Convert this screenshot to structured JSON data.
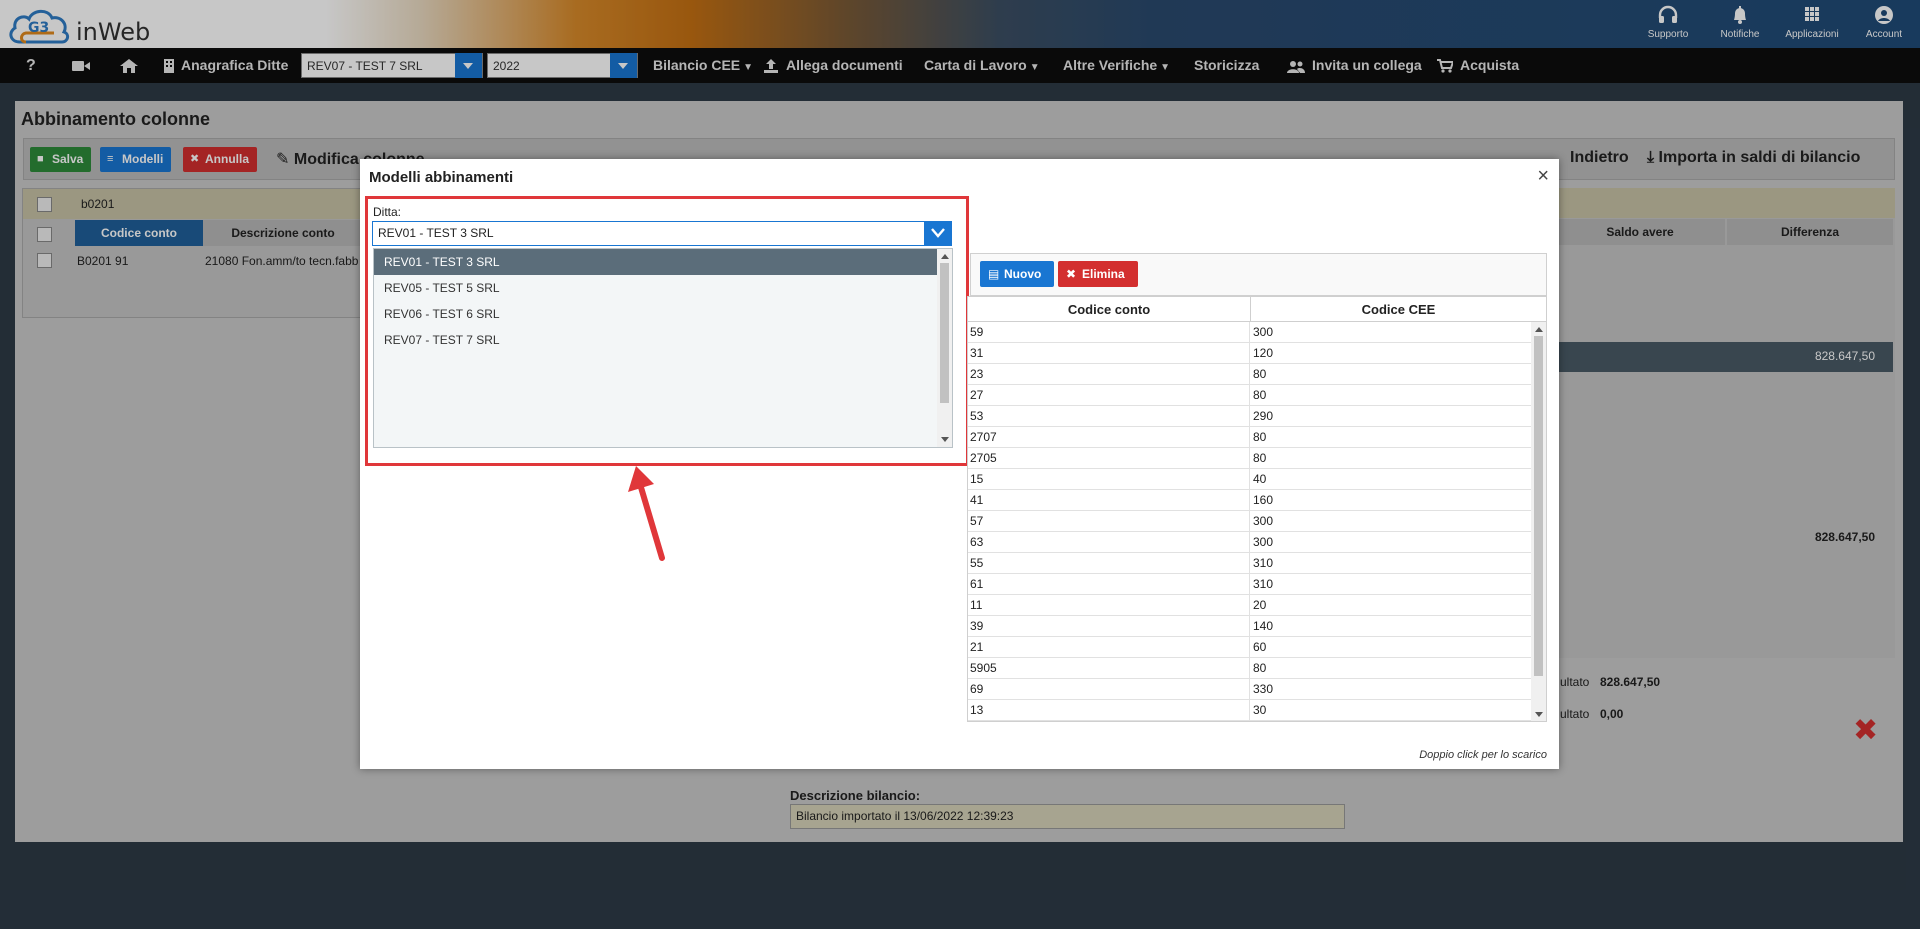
{
  "header": {
    "brand": "inWeb",
    "icons": [
      {
        "label": "Supporto",
        "icon": "headset-icon"
      },
      {
        "label": "Notifiche",
        "icon": "bell-icon"
      },
      {
        "label": "Applicazioni",
        "icon": "grid-icon"
      },
      {
        "label": "Account",
        "icon": "user-icon"
      }
    ]
  },
  "nav": {
    "help": "?",
    "anagrafica": "Anagrafica Ditte",
    "ditta_value": "REV07 - TEST 7 SRL",
    "year_value": "2022",
    "bilancio": "Bilancio CEE",
    "allega": "Allega documenti",
    "carta": "Carta di Lavoro",
    "altre": "Altre Verifiche",
    "storicizza": "Storicizza",
    "invita": "Invita un collega",
    "acquista": "Acquista"
  },
  "page": {
    "title": "Abbinamento colonne",
    "toolbar": {
      "save": "Salva",
      "models": "Modelli",
      "cancel": "Annulla",
      "modify": "Modifica colonne",
      "back": "Indietro",
      "import": "Importa in saldi di bilancio"
    },
    "grid": {
      "filter_value": "b0201",
      "col_code": "Codice conto",
      "col_desc": "Descrizione conto",
      "row_code": "B0201 91",
      "row_desc": "21080 Fon.amm/to tecn.fabb"
    },
    "right": {
      "col_saldo_avere": "Saldo avere",
      "col_differenza": "Differenza",
      "col_ere": "ere",
      "col_diff2": "Differenza",
      "col_elimina": "Elimina",
      "v_zero": "0,00",
      "v_total": "828.647,50",
      "risultato_label": "ultato",
      "risultato_1": "828.647,50",
      "risultato_2": "0,00"
    },
    "desc_label": "Descrizione bilancio:",
    "desc_value": "Bilancio importato il 13/06/2022 12:39:23"
  },
  "modal": {
    "title": "Modelli abbinamenti",
    "ditta_label": "Ditta:",
    "ditta_selected": "REV01 - TEST 3 SRL",
    "options": [
      "REV01 - TEST 3 SRL",
      "REV05 - TEST 5 SRL",
      "REV06 - TEST 6 SRL",
      "REV07 - TEST 7 SRL"
    ],
    "new_btn": "Nuovo",
    "delete_btn": "Elimina",
    "table": {
      "col1": "Codice conto",
      "col2": "Codice CEE",
      "rows": [
        [
          "59",
          "300"
        ],
        [
          "31",
          "120"
        ],
        [
          "23",
          "80"
        ],
        [
          "27",
          "80"
        ],
        [
          "53",
          "290"
        ],
        [
          "2707",
          "80"
        ],
        [
          "2705",
          "80"
        ],
        [
          "15",
          "40"
        ],
        [
          "41",
          "160"
        ],
        [
          "57",
          "300"
        ],
        [
          "63",
          "300"
        ],
        [
          "55",
          "310"
        ],
        [
          "61",
          "310"
        ],
        [
          "11",
          "20"
        ],
        [
          "39",
          "140"
        ],
        [
          "21",
          "60"
        ],
        [
          "5905",
          "80"
        ],
        [
          "69",
          "330"
        ],
        [
          "13",
          "30"
        ]
      ]
    },
    "hint": "Doppio click per lo scarico"
  },
  "colors": {
    "primary": "#1976d2",
    "danger": "#d32f2f",
    "success": "#2e7d32",
    "highlight": "#e0373a"
  }
}
